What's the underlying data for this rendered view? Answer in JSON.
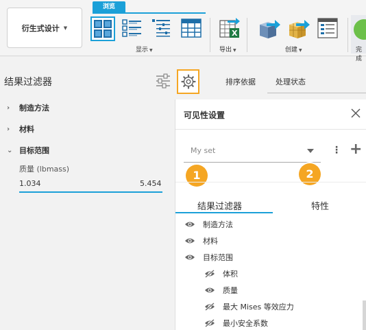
{
  "toolbar": {
    "mode_button": "衍生式设计",
    "view_tab": "浏览",
    "groups": {
      "display": "显示",
      "export": "导出",
      "create": "创建",
      "finish": "完成"
    }
  },
  "left_panel": {
    "title": "结果过滤器",
    "items": [
      {
        "label": "制造方法",
        "expanded": false
      },
      {
        "label": "材料",
        "expanded": false
      },
      {
        "label": "目标范围",
        "expanded": true
      }
    ],
    "range": {
      "label": "质量 (lbmass)",
      "min": "1.034",
      "max": "5.454"
    }
  },
  "tabs": {
    "sort": "排序依据",
    "status": "处理状态"
  },
  "visibility_panel": {
    "title": "可见性设置",
    "set_value": "My set",
    "callouts": [
      "1",
      "2"
    ],
    "tabs": [
      "结果过滤器",
      "特性"
    ],
    "rows": [
      {
        "label": "制造方法",
        "visible": true,
        "indent": 0
      },
      {
        "label": "材料",
        "visible": true,
        "indent": 0
      },
      {
        "label": "目标范围",
        "visible": true,
        "indent": 0
      },
      {
        "label": "体积",
        "visible": false,
        "indent": 1
      },
      {
        "label": "质量",
        "visible": true,
        "indent": 1
      },
      {
        "label": "最大 Mises 等效应力",
        "visible": false,
        "indent": 1
      },
      {
        "label": "最小安全系数",
        "visible": false,
        "indent": 1
      }
    ]
  },
  "colors": {
    "accent": "#1ba0d8",
    "callout": "#f5a623",
    "finish": "#6cc04a"
  }
}
